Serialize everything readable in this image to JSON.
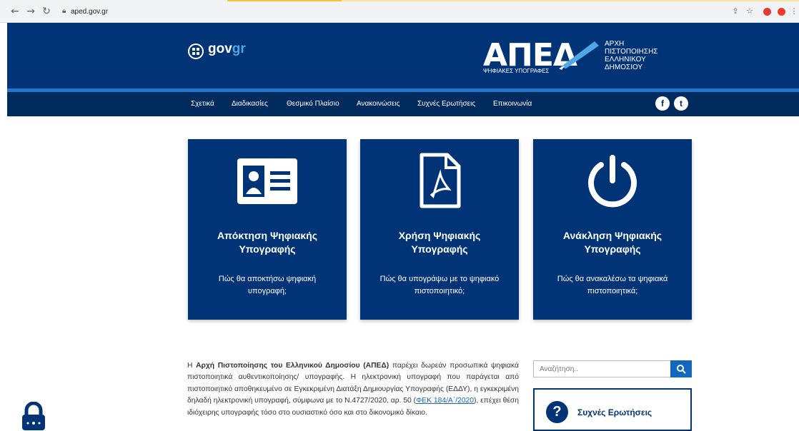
{
  "browser": {
    "url": "aped.gov.gr",
    "back_icon": "arrow-left-icon",
    "forward_icon": "arrow-right-icon",
    "reload_icon": "reload-icon"
  },
  "header": {
    "gov_brand": "gov",
    "gov_brand_accent": "gr",
    "logo_text": "ΑΠΕΔ",
    "logo_subtitle": "ΨΗΦΙΑΚΕΣ ΥΠΟΓΡΑΦΕΣ",
    "org_line1": "ΑΡΧΗ",
    "org_line2": "ΠΙΣΤΟΠΟΙΗΣΗΣ",
    "org_line3": "ΕΛΛΗΝΙΚΟΥ",
    "org_line4": "ΔΗΜΟΣΙΟΥ"
  },
  "nav": {
    "items": [
      "Σχετικά",
      "Διαδικασίες",
      "Θεσμικό Πλαίσιο",
      "Ανακοινώσεις",
      "Συχνές Ερωτήσεις",
      "Επικοινωνία"
    ],
    "facebook": "f",
    "twitter": "t"
  },
  "cards": [
    {
      "title_line1": "Απόκτηση Ψηφιακής",
      "title_line2": "Υπογραφής",
      "desc_line1": "Πώς θα αποκτήσω ψηφιακή",
      "desc_line2": "υπογραφή;",
      "icon": "id-card-icon"
    },
    {
      "title_line1": "Χρήση Ψηφιακής",
      "title_line2": "Υπογραφής",
      "desc_line1": "Πώς θα υπογράψω με το ψηφιακό",
      "desc_line2": "πιστοποιητικό;",
      "icon": "pdf-document-icon"
    },
    {
      "title_line1": "Ανάκληση Ψηφιακής",
      "title_line2": "Υπογραφής",
      "desc_line1": "Πώς θα ανακαλέσω τα ψηφιακά",
      "desc_line2": "πιστοποιητικά;",
      "icon": "power-icon"
    }
  ],
  "intro": {
    "prefix": "Η ",
    "bold": "Αρχή Πιστοποίησης του Ελληνικού Δημοσίου (ΑΠΕΔ)",
    "text1": " παρέχει δωρεάν προσωπικά ψηφιακά πιστοποιητικά αυθεντικοποίησης/ υπογραφής. Η ηλεκτρονική υπογραφή που παράγεται από πιστοποιητικό αποθηκευμένο σε Εγκεκριμένη Διατάξη Δημιουργίας Υπογραφής (ΕΔΔΥ), η εγκεκριμένη δηλαδή ηλεκτρονική υπογραφή, σύμφωνα με το Ν.4727/2020, αρ. 50 (",
    "link": "ΦΕΚ 184/Α΄/2020",
    "text2": "), επέχει θέση ιδιόχειρης υπογραφής τόσο στο ουσιαστικό όσο και στο δικονομικό δίκαιο."
  },
  "sidebar": {
    "search_placeholder": "Αναζήτηση..",
    "faq_label": "Συχνές Ερωτήσεις",
    "faq_icon": "question-icon"
  },
  "colors": {
    "primary": "#003476",
    "nav": "#002b5c",
    "accent": "#2376c9"
  }
}
